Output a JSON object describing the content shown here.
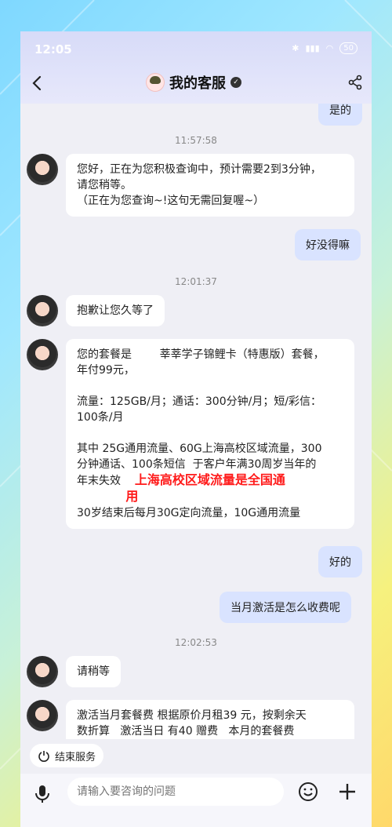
{
  "status_bar": {
    "time": "12:05",
    "battery": "50"
  },
  "header": {
    "title": "我的客服"
  },
  "messages": {
    "prev_right": "是的",
    "t1": "11:57:58",
    "m1_line1": "您好，正在为您积极查询中，预计需要2到3分钟，",
    "m1_line2": "请您稍等。",
    "m1_line3": "（正在为您查询~!这句无需回复喔~）",
    "r1": "好没得嘛",
    "t2": "12:01:37",
    "m2": "抱歉让您久等了",
    "m3_l1": "您的套餐是        莘莘学子锦鲤卡（特惠版）套餐，",
    "m3_l2": "年付99元，",
    "m3_l3": "流量：125GB/月；通话：300分钟/月；短/彩信：",
    "m3_l4": "100条/月",
    "m3_l5": "其中 25G通用流量、60G上海高校区域流量，300",
    "m3_l6": "分钟通话、100条短信  于客户年满30周岁当年的",
    "m3_l7": "年末失效",
    "m3_red1": "上海高校区域流量是全国通",
    "m3_red2": "用",
    "m3_l8": "30岁结束后每月30G定向流量，10G通用流量",
    "r2": "好的",
    "r3": "当月激活是怎么收费呢",
    "t3": "12:02:53",
    "m4": "请稍等",
    "m5_l1": "激活当月套餐费 根据原价月租39 元，按剩余天",
    "m5_l2": "数折算   激活当日 有40 赠费   本月的套餐费"
  },
  "bottom": {
    "end_service": "结束服务",
    "input_placeholder": "请输入要咨询的问题"
  }
}
